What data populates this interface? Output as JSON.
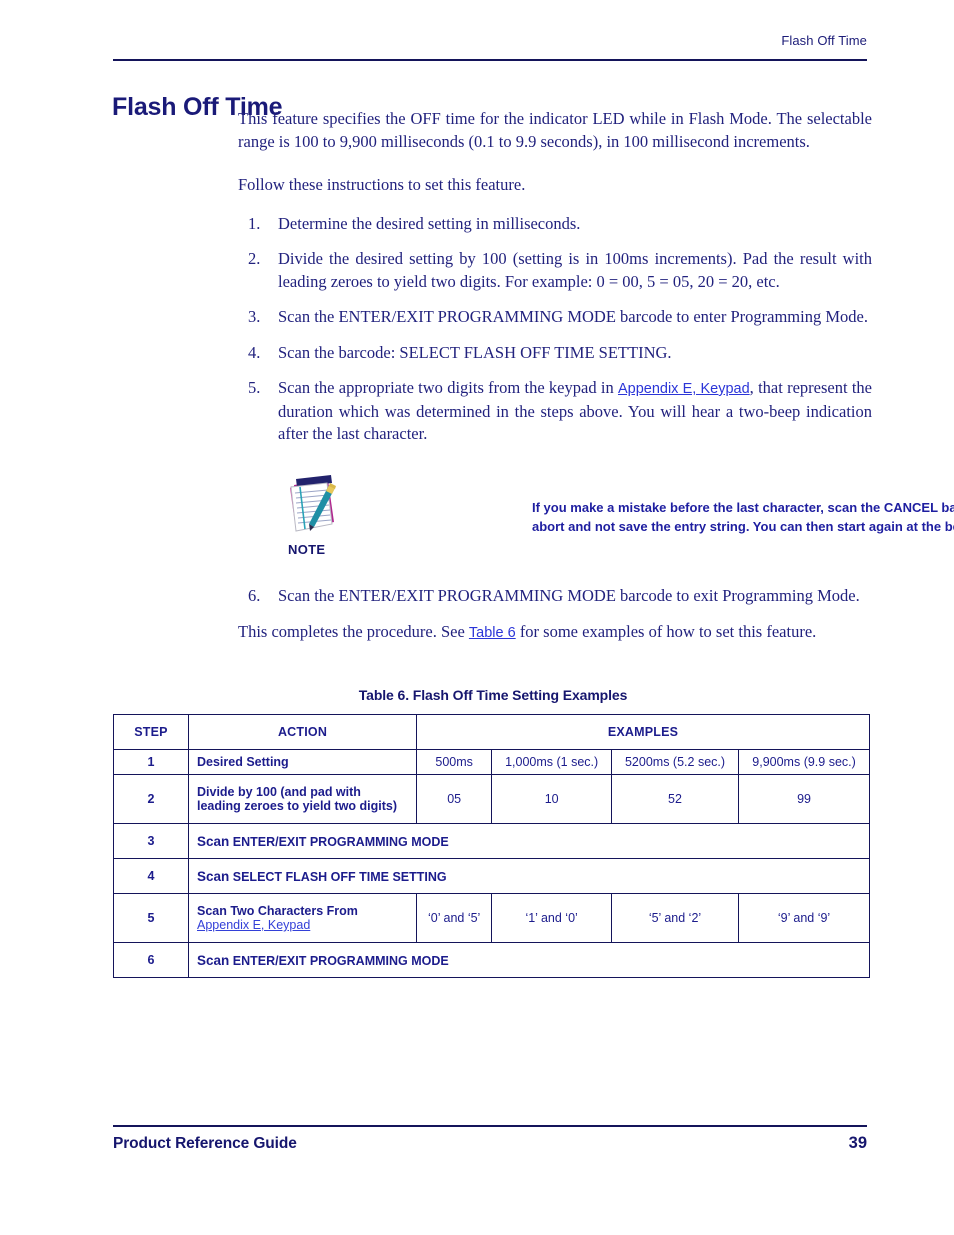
{
  "header": {
    "running_head": "Flash Off Time"
  },
  "title": "Flash Off Time",
  "intro": {
    "paragraph": "This feature specifies the OFF time for the indicator LED while in Flash Mode. The selectable range is 100 to 9,900 milliseconds (0.1 to 9.9 seconds), in 100 millisecond increments.",
    "follow": "Follow these instructions to set this feature."
  },
  "steps": [
    {
      "num": "1.",
      "text": "Determine the desired setting in milliseconds."
    },
    {
      "num": "2.",
      "text": "Divide the desired setting by 100 (setting is in 100ms increments). Pad the result with leading zeroes to yield two digits. For example: 0 = 00, 5 = 05, 20 = 20, etc."
    },
    {
      "num": "3.",
      "text": "Scan the ENTER/EXIT PROGRAMMING MODE barcode to enter Programming Mode."
    },
    {
      "num": "4.",
      "text": "Scan the barcode: SELECT FLASH OFF TIME SETTING."
    },
    {
      "num": "5.",
      "text_before": "Scan the appropriate two digits from the keypad in ",
      "link": "Appendix E, Keypad",
      "text_after": ", that represent the duration which was determined in the steps above. You will hear a two-beep indication after the last character."
    }
  ],
  "note": {
    "icon": "notepad-pencil-icon",
    "label": "NOTE",
    "line1": "If you make a mistake before the last character, scan the CANCEL barcode to",
    "line2": "abort and not save the entry string. You can then start again at the beginning."
  },
  "closing": {
    "step": {
      "num": "6.",
      "text": "Scan the ENTER/EXIT PROGRAMMING MODE barcode to exit Programming Mode."
    },
    "text_before": "This completes the procedure. See ",
    "link": "Table 6",
    "text_after": " for some examples of how to set this feature."
  },
  "table": {
    "caption": "Table 6. Flash Off Time Setting Examples",
    "headers": {
      "step": "STEP",
      "action": "ACTION",
      "examples": "EXAMPLES"
    },
    "rows": [
      {
        "step": "1",
        "action": "Desired Setting",
        "examples": [
          "500ms",
          "1,000ms (1 sec.)",
          "5200ms (5.2 sec.)",
          "9,900ms (9.9 sec.)"
        ]
      },
      {
        "step": "2",
        "action_line1": "Divide by 100 (and pad with",
        "action_line2": "leading zeroes to yield two digits)",
        "examples": [
          "05",
          "10",
          "52",
          "99"
        ]
      },
      {
        "step": "3",
        "action_scan": "Scan",
        "action_rest": " ENTER/EXIT PROGRAMMING MODE",
        "span": true
      },
      {
        "step": "4",
        "action_scan": "Scan",
        "action_rest": " SELECT FLASH OFF TIME SETTING",
        "span": true
      },
      {
        "step": "5",
        "action": "Scan Two Characters From",
        "action_link": "Appendix E, Keypad",
        "examples": [
          "‘0’ and ‘5’",
          "‘1’ and ‘0’",
          "‘5’ and ‘2’",
          "‘9’ and ‘9’"
        ]
      },
      {
        "step": "6",
        "action_scan": "Scan",
        "action_rest": " ENTER/EXIT PROGRAMMING MODE",
        "span": true
      }
    ]
  },
  "footer": {
    "title": "Product Reference Guide",
    "page": "39"
  },
  "colors": {
    "navy": "#16166e",
    "body_text": "#22227e",
    "link": "#2b35d8",
    "rule": "#14145a"
  }
}
